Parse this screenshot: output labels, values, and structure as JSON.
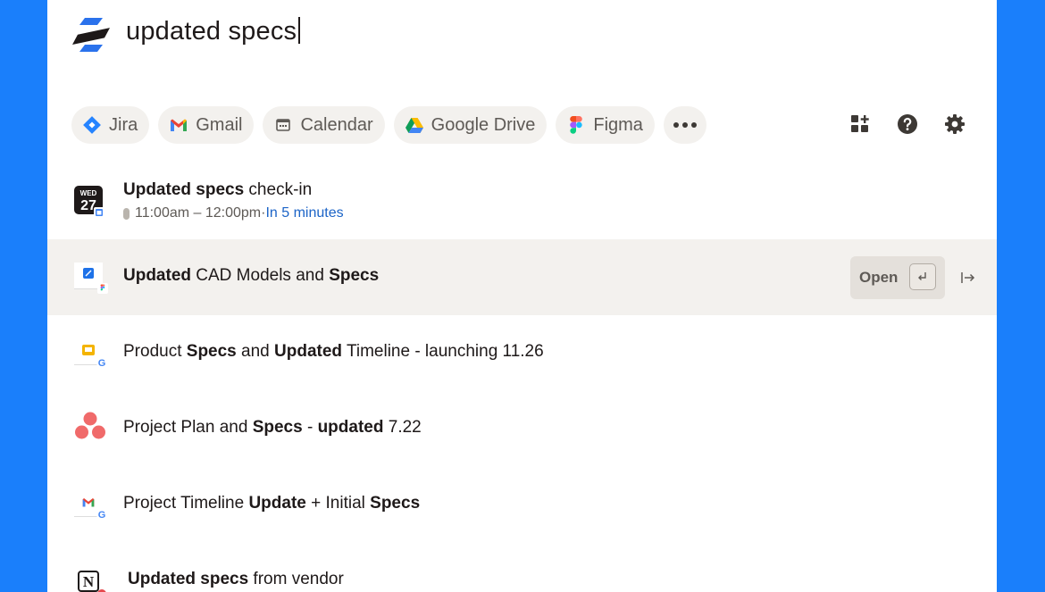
{
  "search": {
    "query": "updated specs"
  },
  "filters": [
    {
      "label": "Jira",
      "icon": "jira-icon"
    },
    {
      "label": "Gmail",
      "icon": "gmail-icon"
    },
    {
      "label": "Calendar",
      "icon": "calendar-icon"
    },
    {
      "label": "Google Drive",
      "icon": "google-drive-icon"
    },
    {
      "label": "Figma",
      "icon": "figma-icon"
    }
  ],
  "toolbar": {
    "apps_icon": "apps-icon",
    "help_icon": "help-icon",
    "settings_icon": "gear-icon"
  },
  "event": {
    "day": "WED",
    "date": "27",
    "title_bold": "Updated specs",
    "title_rest": " check-in",
    "time": "11:00am – 12:00pm",
    "separator": " · ",
    "starts": "In 5 minutes"
  },
  "results": [
    {
      "parts": [
        [
          "Updated",
          true
        ],
        [
          " CAD Models and ",
          false
        ],
        [
          "Specs",
          true
        ]
      ],
      "icon": "figma-file-icon"
    },
    {
      "parts": [
        [
          "Product ",
          false
        ],
        [
          "Specs",
          true
        ],
        [
          " and ",
          false
        ],
        [
          "Updated",
          true
        ],
        [
          " Timeline - launching 11.26",
          false
        ]
      ],
      "icon": "google-slides-icon"
    },
    {
      "parts": [
        [
          "Project Plan and ",
          false
        ],
        [
          "Specs",
          true
        ],
        [
          " - ",
          false
        ],
        [
          "updated",
          true
        ],
        [
          " 7.22",
          false
        ]
      ],
      "icon": "asana-icon"
    },
    {
      "parts": [
        [
          "Project Timeline ",
          false
        ],
        [
          "Update",
          true
        ],
        [
          " + Initial ",
          false
        ],
        [
          "Specs",
          true
        ]
      ],
      "icon": "gmail-file-icon"
    },
    {
      "parts": [
        [
          "Updated specs",
          true
        ],
        [
          " from vendor",
          false
        ]
      ],
      "icon": "notion-icon"
    }
  ],
  "selected_actions": {
    "open_label": "Open",
    "enter_icon": "enter-key-icon",
    "pin_icon": "pin-to-side-icon"
  },
  "colors": {
    "background": "#1a7ffb",
    "chip_bg": "#f3f1ee",
    "selected_row": "#f3f1ee",
    "link_blue": "#1c64c7"
  }
}
